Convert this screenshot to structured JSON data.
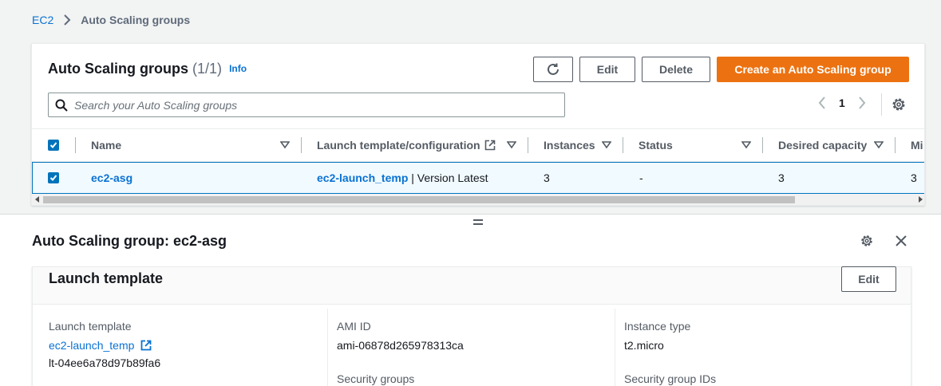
{
  "breadcrumb": {
    "root": "EC2",
    "current": "Auto Scaling groups"
  },
  "list_panel": {
    "title": "Auto Scaling groups",
    "count": "(1/1)",
    "info_label": "Info",
    "buttons": {
      "edit": "Edit",
      "delete": "Delete",
      "create": "Create an Auto Scaling group"
    },
    "search_placeholder": "Search your Auto Scaling groups",
    "page_number": "1",
    "columns": [
      "Name",
      "Launch template/configuration",
      "Instances",
      "Status",
      "Desired capacity",
      "Mi"
    ],
    "rows": [
      {
        "name": "ec2-asg",
        "launch_template_link": "ec2-launch_temp",
        "launch_template_suffix": "| Version Latest",
        "instances": "3",
        "status": "-",
        "desired_capacity": "3",
        "min": "3"
      }
    ]
  },
  "detail_panel": {
    "title": "Auto Scaling group: ec2-asg",
    "section": {
      "title": "Launch template",
      "edit_label": "Edit",
      "fields": {
        "launch_template_label": "Launch template",
        "launch_template_link": "ec2-launch_temp",
        "launch_template_id": "lt-04ee6a78d97b89fa6",
        "ami_id_label": "AMI ID",
        "ami_id": "ami-06878d265978313ca",
        "security_groups_label": "Security groups",
        "instance_type_label": "Instance type",
        "instance_type": "t2.micro",
        "security_group_ids_label": "Security group IDs"
      }
    }
  },
  "colors": {
    "primary": "#ec7211",
    "link": "#0972d3",
    "selected_row": "#f1faff",
    "checkbox": "#0073bb"
  }
}
